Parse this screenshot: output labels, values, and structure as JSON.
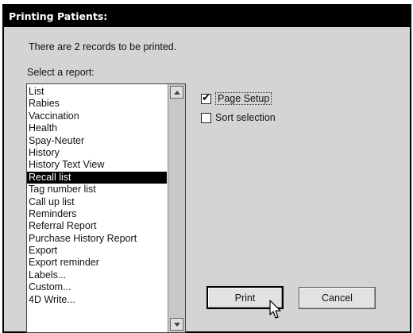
{
  "dialog": {
    "title": "Printing Patients:",
    "records_text": "There are 2 records to be printed.",
    "select_label": "Select a report:"
  },
  "reports": [
    {
      "label": "List",
      "selected": false
    },
    {
      "label": "Rabies",
      "selected": false
    },
    {
      "label": "Vaccination",
      "selected": false
    },
    {
      "label": "Health",
      "selected": false
    },
    {
      "label": "Spay-Neuter",
      "selected": false
    },
    {
      "label": "History",
      "selected": false
    },
    {
      "label": "History Text View",
      "selected": false
    },
    {
      "label": "Recall list",
      "selected": true
    },
    {
      "label": "Tag number list",
      "selected": false
    },
    {
      "label": "Call up list",
      "selected": false
    },
    {
      "label": "Reminders",
      "selected": false
    },
    {
      "label": "Referral Report",
      "selected": false
    },
    {
      "label": "Purchase History Report",
      "selected": false
    },
    {
      "label": "Export",
      "selected": false
    },
    {
      "label": "Export reminder",
      "selected": false
    },
    {
      "label": "Labels...",
      "selected": false
    },
    {
      "label": "Custom...",
      "selected": false
    },
    {
      "label": "4D Write...",
      "selected": false
    }
  ],
  "options": {
    "page_setup": {
      "label": "Page Setup",
      "checked": true
    },
    "sort_selection": {
      "label": "Sort selection",
      "checked": false
    }
  },
  "buttons": {
    "print": "Print",
    "cancel": "Cancel"
  }
}
